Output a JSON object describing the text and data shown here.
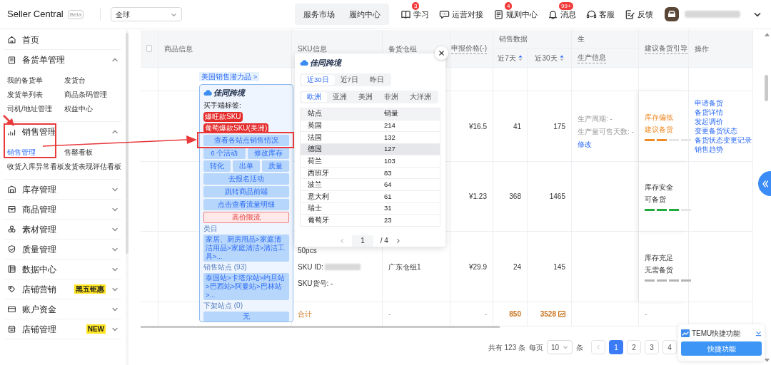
{
  "top_bar": {
    "brand": "Seller Central",
    "badge": "Beta",
    "region_select": "全球",
    "tabs": [
      {
        "label": "服务市场"
      },
      {
        "label": "履约中心"
      }
    ],
    "nav": [
      {
        "label": "学习",
        "count": "3"
      },
      {
        "label": "运营对接"
      },
      {
        "label": "规则中心",
        "count": "4"
      },
      {
        "label": "消息",
        "count": "99+"
      },
      {
        "label": "客服"
      },
      {
        "label": "反馈"
      }
    ]
  },
  "sidebar": {
    "items": [
      {
        "label": "首页"
      },
      {
        "label": "备货单管理",
        "expanded": true,
        "children": [
          {
            "label": "我的备货单",
            "selected": false
          },
          {
            "label": "发货台",
            "selected": false
          },
          {
            "label": "发货单列表",
            "selected": false
          },
          {
            "label": "商品条码管理",
            "selected": false
          },
          {
            "label": "司机/地址管理",
            "selected": false
          },
          {
            "label": "权益中心",
            "selected": false
          }
        ]
      },
      {
        "label": "销售管理",
        "expanded": true,
        "children": [
          {
            "label": "销售管理",
            "selected": true
          },
          {
            "label": "售罄看板",
            "selected": false
          },
          {
            "label": "收货入库异常看板",
            "selected": false
          },
          {
            "label": "发货表现评估看板",
            "selected": false
          }
        ]
      },
      {
        "label": "库存管理",
        "expanded": false
      },
      {
        "label": "商品管理",
        "expanded": false
      },
      {
        "label": "素材管理",
        "expanded": false
      },
      {
        "label": "质量管理",
        "expanded": false
      },
      {
        "label": "数据中心",
        "expanded": false
      },
      {
        "label": "店铺营销",
        "expanded": false,
        "badge": "黑五钜惠"
      },
      {
        "label": "账户资金",
        "expanded": false
      },
      {
        "label": "店铺管理",
        "expanded": false,
        "badge": "NEW"
      }
    ]
  },
  "table": {
    "select_all_checked": false,
    "columns": [
      {
        "label": "商品信息"
      },
      {
        "label": "SKU信息"
      },
      {
        "label": "备货仓组"
      },
      {
        "label": "申报价格(-)"
      },
      {
        "group": "销售数据"
      },
      {
        "group": "生"
      },
      {
        "label": "建议备货引导"
      },
      {
        "label": "操作"
      },
      {
        "label": "近7天",
        "sortable": true
      },
      {
        "label": "近30天",
        "sortable": true
      },
      {
        "label": "生产信息"
      }
    ],
    "rows": [
      {
        "price": "¥16.5",
        "sales_7d": "41",
        "sales_30d": "175",
        "production": [
          "生产周期: -",
          "生产量可售天数: -"
        ],
        "production_link": "修改",
        "advice": [
          "库存偏低",
          "建议备货"
        ],
        "warning": true,
        "color": "#f08a24",
        "level": 0.5,
        "actions": [
          "申请备货",
          "备货详情",
          "发起调价",
          "变更备货状态",
          "备货状态变更记录",
          "销售趋势"
        ]
      },
      {
        "price": "¥1.23",
        "sales_7d": "368",
        "sales_30d": "1465",
        "advice": [
          "库存安全",
          "可备货"
        ],
        "warning": false,
        "color": "#1faa3a",
        "level": 0.75
      },
      {
        "sku": [
          "50pcs",
          "SKU ID:",
          "SKU货号: -"
        ],
        "warehouse": "广东仓组1",
        "price": "¥29.9",
        "sales_7d": "24",
        "sales_30d": "145",
        "advice": [
          "库存充足",
          "无需备货"
        ],
        "warning": false,
        "color": "#b4b4b4",
        "level": 1
      }
    ],
    "total": {
      "label": "合计",
      "warehouse": "-",
      "price": "-",
      "sales_7d": "850",
      "sales_30d": "3528",
      "advice": "-"
    }
  },
  "plugin_card": {
    "link": "美国销售潜力品 >",
    "logo": "佳同跨境",
    "tag_label": "买手端标签:",
    "tags": [
      "爆旺款SKU",
      "葡萄爆款SKU(美洲)"
    ],
    "button_rows": [
      [
        "查看各站点销售情况"
      ],
      [
        "6 个活动",
        "修改库存"
      ],
      [
        "转化",
        "出单",
        "质量"
      ],
      [
        "去报名活动"
      ],
      [
        "跳转商品前端"
      ],
      [
        "点击查看流量明细"
      ]
    ],
    "alert": "高价限流",
    "sections": [
      {
        "title": "类目",
        "text": "家居、厨房用品>家庭清洁用品>家庭清洁>清洁工具>..."
      },
      {
        "title": "销售站点 (93)",
        "text": "泰国站>卡塔尔站>约旦站>巴西站>阿曼站>巴林站>..."
      },
      {
        "title": "下架站点 (0)",
        "text": "无"
      }
    ]
  },
  "sales_popup": {
    "logo": "佳同跨境",
    "periods": [
      {
        "label": "近30日",
        "selected": true
      },
      {
        "label": "近7日",
        "selected": false
      },
      {
        "label": "昨日",
        "selected": false
      }
    ],
    "regions": [
      {
        "label": "欧洲",
        "selected": true
      },
      {
        "label": "亚洲",
        "selected": false
      },
      {
        "label": "美洲",
        "selected": false
      },
      {
        "label": "非洲",
        "selected": false
      },
      {
        "label": "大洋洲",
        "selected": false
      }
    ],
    "columns": [
      "站点",
      "销量"
    ],
    "rows": [
      {
        "site": "英国",
        "sales": "214",
        "hovered": false
      },
      {
        "site": "法国",
        "sales": "132",
        "hovered": false
      },
      {
        "site": "德国",
        "sales": "127",
        "hovered": true
      },
      {
        "site": "荷兰",
        "sales": "103",
        "hovered": false
      },
      {
        "site": "西班牙",
        "sales": "83",
        "hovered": false
      },
      {
        "site": "波兰",
        "sales": "64",
        "hovered": false
      },
      {
        "site": "意大利",
        "sales": "61",
        "hovered": false
      },
      {
        "site": "瑞士",
        "sales": "31",
        "hovered": false
      },
      {
        "site": "葡萄牙",
        "sales": "23",
        "hovered": false
      }
    ],
    "page": "1",
    "pages": "/ 4"
  },
  "pagination": {
    "total": "共有 123 条",
    "per_page_label": "每页",
    "per_page": "10",
    "unit": "条",
    "pages": [
      {
        "label": "1",
        "selected": true
      },
      {
        "label": "2",
        "selected": false
      },
      {
        "label": "3",
        "selected": false
      },
      {
        "label": "4",
        "selected": false
      }
    ]
  },
  "quick_widget": {
    "title": "TEMU快捷功能",
    "button": "快捷功能"
  }
}
